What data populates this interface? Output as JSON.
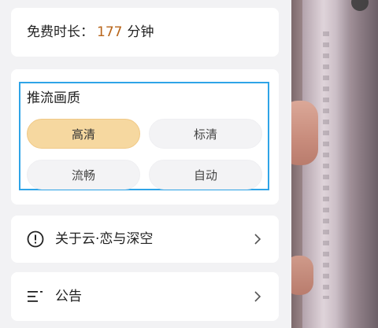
{
  "free_time": {
    "label": "免费时长：",
    "value": "177",
    "unit": "分钟"
  },
  "stream_quality": {
    "title": "推流画质",
    "options": [
      {
        "label": "高清",
        "selected": true
      },
      {
        "label": "标清",
        "selected": false
      },
      {
        "label": "流畅",
        "selected": false
      },
      {
        "label": "自动",
        "selected": false
      }
    ]
  },
  "menu": {
    "about": {
      "label": "关于云·恋与深空",
      "icon": "info-circle-icon"
    },
    "notice": {
      "label": "公告",
      "icon": "list-icon"
    }
  },
  "colors": {
    "accent_value": "#b8651a",
    "selected_bg": "#f6d8a0",
    "highlight_border": "#2fa4e7"
  }
}
